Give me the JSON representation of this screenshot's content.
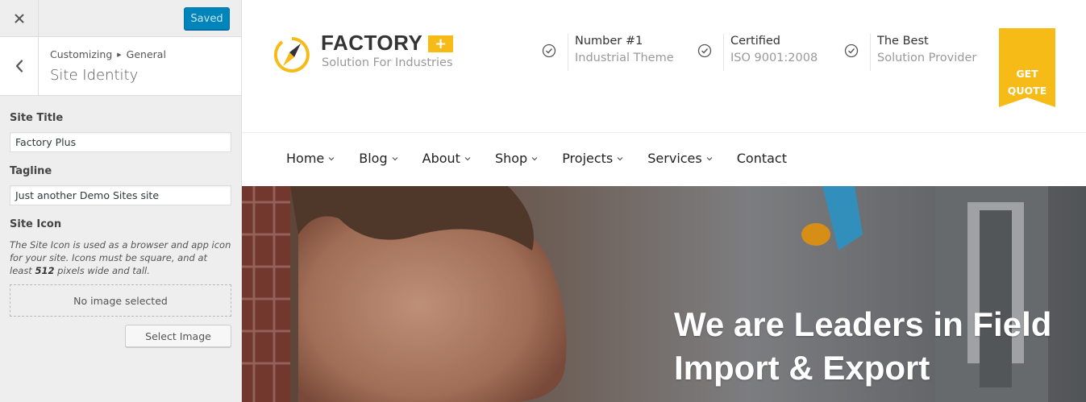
{
  "customizer": {
    "saved_label": "Saved",
    "breadcrumb": [
      "Customizing",
      "General"
    ],
    "panel_title": "Site Identity",
    "site_title": {
      "label": "Site Title",
      "value": "Factory Plus"
    },
    "tagline": {
      "label": "Tagline",
      "value": "Just another Demo Sites site"
    },
    "site_icon": {
      "label": "Site Icon",
      "desc_before": "The Site Icon is used as a browser and app icon for your site. Icons must be square, and at least ",
      "desc_bold": "512",
      "desc_after": " pixels wide and tall.",
      "no_image": "No image selected",
      "select_button": "Select Image"
    }
  },
  "site": {
    "logo": {
      "name": "FACTORY",
      "plus": "+",
      "tagline": "Solution For Industries"
    },
    "info": [
      {
        "title": "Number #1",
        "subtitle": "Industrial Theme"
      },
      {
        "title": "Certified",
        "subtitle": "ISO 9001:2008"
      },
      {
        "title": "The Best",
        "subtitle": "Solution Provider"
      }
    ],
    "quote": [
      "GET",
      "QUOTE"
    ],
    "nav": [
      "Home",
      "Blog",
      "About",
      "Shop",
      "Projects",
      "Services",
      "Contact"
    ],
    "hero": {
      "line1": "We are Leaders in Field",
      "line2": "Import & Export"
    },
    "colors": {
      "accent": "#f7bb17",
      "primary_button": "#0085ba"
    }
  }
}
